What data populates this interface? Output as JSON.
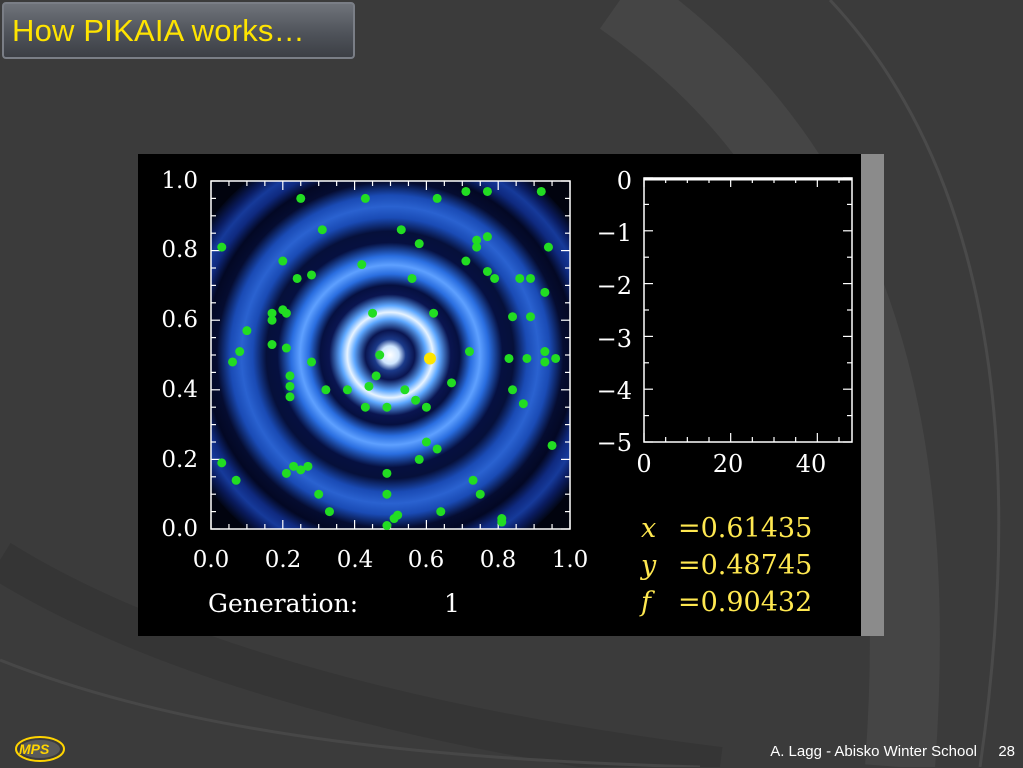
{
  "slide": {
    "title": "How PIKAIA works…",
    "footer": "A. Lagg - Abisko Winter School",
    "page_number": "28",
    "logo_text": "MPS"
  },
  "figure": {
    "generation_label": "Generation:",
    "generation_value": "1",
    "readout": [
      {
        "var": "x",
        "value": "=0.61435"
      },
      {
        "var": "y",
        "value": "=0.48745"
      },
      {
        "var": "f",
        "value": "=0.90432"
      }
    ]
  },
  "chart_data": [
    {
      "type": "scatter",
      "title": "",
      "xlabel": "",
      "ylabel": "",
      "xlim": [
        0,
        1
      ],
      "ylim": [
        0,
        1
      ],
      "xticks": [
        "0.0",
        "0.2",
        "0.4",
        "0.6",
        "0.8",
        "1.0"
      ],
      "yticks": [
        "0.0",
        "0.2",
        "0.4",
        "0.6",
        "0.8",
        "1.0"
      ],
      "background": "concentric-ring fitness landscape centered at (0.5, 0.5)",
      "colors": {
        "population": "#22dd22",
        "best": "#ffe600",
        "rings": "#3a7dff"
      },
      "best_point": {
        "x": 0.61,
        "y": 0.49
      },
      "points": [
        [
          0.25,
          0.95
        ],
        [
          0.43,
          0.95
        ],
        [
          0.63,
          0.95
        ],
        [
          0.77,
          0.97
        ],
        [
          0.71,
          0.97
        ],
        [
          0.92,
          0.97
        ],
        [
          0.03,
          0.81
        ],
        [
          0.31,
          0.86
        ],
        [
          0.53,
          0.86
        ],
        [
          0.58,
          0.82
        ],
        [
          0.74,
          0.81
        ],
        [
          0.77,
          0.84
        ],
        [
          0.74,
          0.83
        ],
        [
          0.94,
          0.81
        ],
        [
          0.2,
          0.77
        ],
        [
          0.28,
          0.73
        ],
        [
          0.24,
          0.72
        ],
        [
          0.42,
          0.76
        ],
        [
          0.56,
          0.72
        ],
        [
          0.71,
          0.77
        ],
        [
          0.77,
          0.74
        ],
        [
          0.79,
          0.72
        ],
        [
          0.86,
          0.72
        ],
        [
          0.89,
          0.72
        ],
        [
          0.93,
          0.68
        ],
        [
          0.17,
          0.62
        ],
        [
          0.2,
          0.63
        ],
        [
          0.17,
          0.6
        ],
        [
          0.1,
          0.57
        ],
        [
          0.21,
          0.62
        ],
        [
          0.45,
          0.62
        ],
        [
          0.62,
          0.62
        ],
        [
          0.84,
          0.61
        ],
        [
          0.89,
          0.61
        ],
        [
          0.08,
          0.51
        ],
        [
          0.06,
          0.48
        ],
        [
          0.17,
          0.53
        ],
        [
          0.21,
          0.52
        ],
        [
          0.28,
          0.48
        ],
        [
          0.47,
          0.5
        ],
        [
          0.72,
          0.51
        ],
        [
          0.83,
          0.49
        ],
        [
          0.88,
          0.49
        ],
        [
          0.93,
          0.48
        ],
        [
          0.96,
          0.49
        ],
        [
          0.93,
          0.51
        ],
        [
          0.22,
          0.44
        ],
        [
          0.22,
          0.41
        ],
        [
          0.32,
          0.4
        ],
        [
          0.38,
          0.4
        ],
        [
          0.44,
          0.41
        ],
        [
          0.46,
          0.44
        ],
        [
          0.54,
          0.4
        ],
        [
          0.57,
          0.37
        ],
        [
          0.67,
          0.42
        ],
        [
          0.84,
          0.4
        ],
        [
          0.22,
          0.38
        ],
        [
          0.43,
          0.35
        ],
        [
          0.49,
          0.35
        ],
        [
          0.6,
          0.35
        ],
        [
          0.87,
          0.36
        ],
        [
          0.6,
          0.25
        ],
        [
          0.63,
          0.23
        ],
        [
          0.58,
          0.2
        ],
        [
          0.95,
          0.24
        ],
        [
          0.03,
          0.19
        ],
        [
          0.25,
          0.17
        ],
        [
          0.23,
          0.18
        ],
        [
          0.27,
          0.18
        ],
        [
          0.21,
          0.16
        ],
        [
          0.49,
          0.16
        ],
        [
          0.73,
          0.14
        ],
        [
          0.07,
          0.14
        ],
        [
          0.3,
          0.1
        ],
        [
          0.49,
          0.1
        ],
        [
          0.75,
          0.1
        ],
        [
          0.33,
          0.05
        ],
        [
          0.52,
          0.04
        ],
        [
          0.51,
          0.03
        ],
        [
          0.49,
          0.01
        ],
        [
          0.64,
          0.05
        ],
        [
          0.81,
          0.03
        ],
        [
          0.81,
          0.02
        ]
      ]
    },
    {
      "type": "line",
      "title": "",
      "xlabel": "",
      "ylabel": "",
      "xlim": [
        0,
        48
      ],
      "ylim": [
        -5,
        0
      ],
      "xticks": [
        "0",
        "20",
        "40"
      ],
      "yticks": [
        "0",
        "−1",
        "−2",
        "−3",
        "−4",
        "−5"
      ],
      "series": [
        {
          "x": [
            0,
            48
          ],
          "y": [
            0,
            0
          ]
        }
      ]
    }
  ]
}
